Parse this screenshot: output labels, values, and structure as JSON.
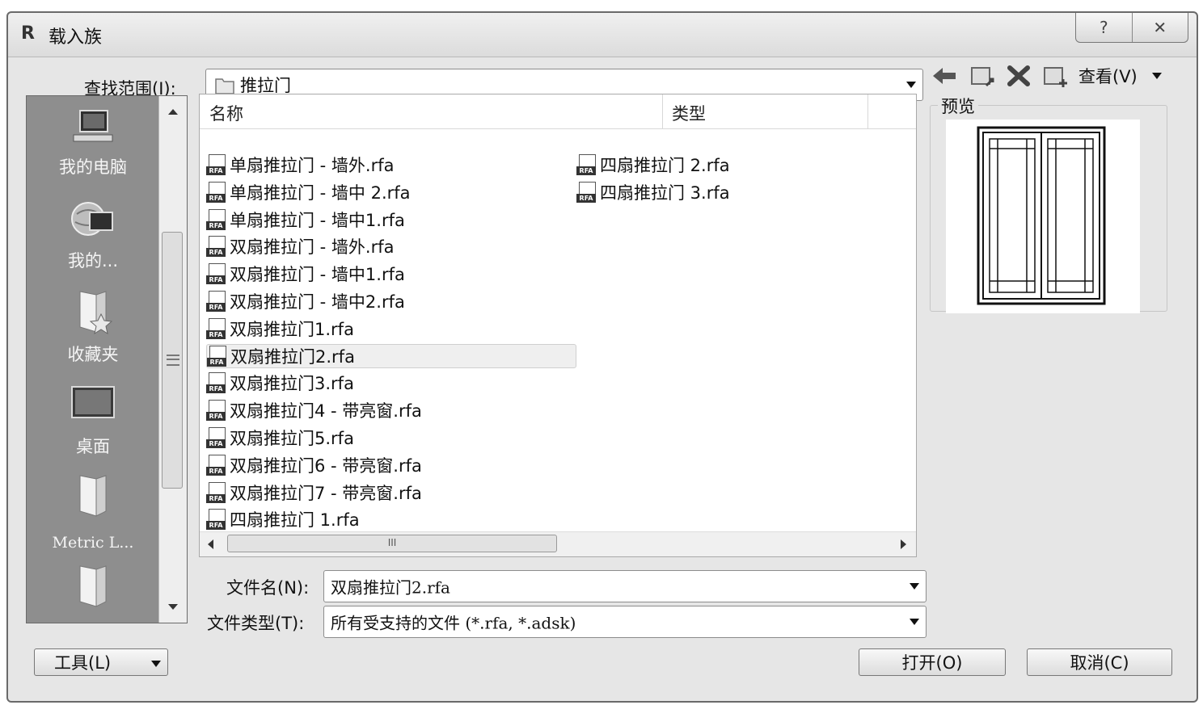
{
  "window": {
    "title": "载入族",
    "app_icon": "R",
    "help_label": "?",
    "close_label": "✕"
  },
  "lookin": {
    "label": "查找范围(I):",
    "value": "推拉门"
  },
  "toolbar": {
    "view_label": "查看(V)"
  },
  "places": [
    {
      "label": "我的电脑",
      "icon": "computer-icon"
    },
    {
      "label": "我的...",
      "icon": "network-icon"
    },
    {
      "label": "收藏夹",
      "icon": "favorites-icon"
    },
    {
      "label": "桌面",
      "icon": "desktop-icon"
    },
    {
      "label": "Metric L...",
      "icon": "folder-icon"
    },
    {
      "label": "",
      "icon": "folder-icon"
    }
  ],
  "columns": {
    "name": "名称",
    "type": "类型"
  },
  "files_col1": [
    "单扇推拉门 - 墙外.rfa",
    "单扇推拉门 - 墙中 2.rfa",
    "单扇推拉门 - 墙中1.rfa",
    "双扇推拉门 - 墙外.rfa",
    "双扇推拉门 - 墙中1.rfa",
    "双扇推拉门 - 墙中2.rfa",
    "双扇推拉门1.rfa",
    "双扇推拉门2.rfa",
    "双扇推拉门3.rfa",
    "双扇推拉门4 - 带亮窗.rfa",
    "双扇推拉门5.rfa",
    "双扇推拉门6 - 带亮窗.rfa",
    "双扇推拉门7 - 带亮窗.rfa",
    "四扇推拉门 1.rfa"
  ],
  "files_col2": [
    "四扇推拉门 2.rfa",
    "四扇推拉门 3.rfa"
  ],
  "selected_file": "双扇推拉门2.rfa",
  "preview": {
    "label": "预览"
  },
  "filename": {
    "label": "文件名(N):",
    "value": "双扇推拉门2.rfa"
  },
  "filetype": {
    "label": "文件类型(T):",
    "value": "所有受支持的文件 (*.rfa, *.adsk)"
  },
  "buttons": {
    "tools": "工具(L)",
    "open": "打开(O)",
    "cancel": "取消(C)"
  }
}
